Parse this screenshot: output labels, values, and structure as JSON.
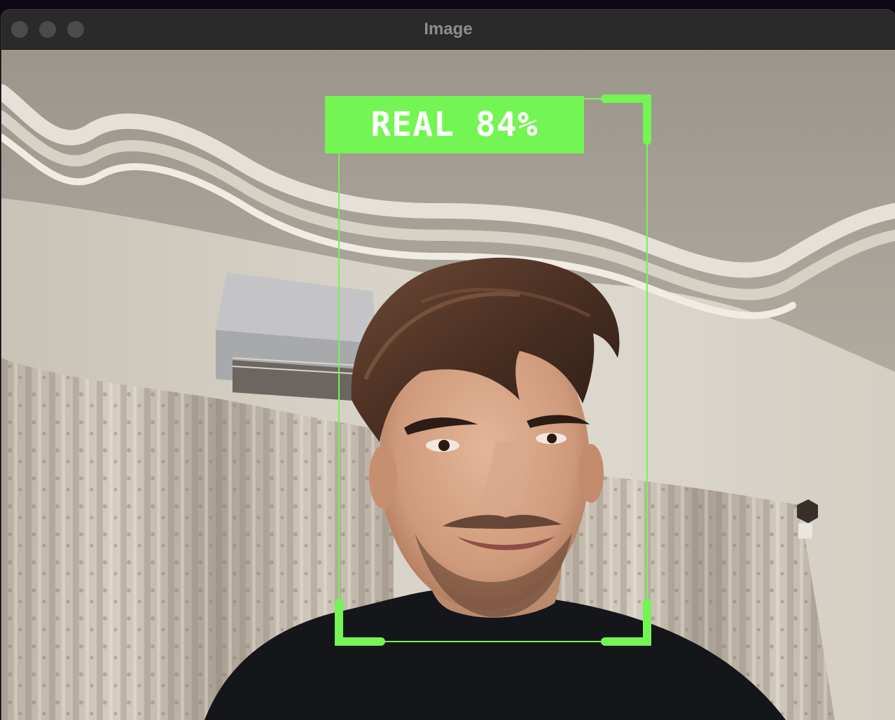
{
  "window": {
    "title": "Image"
  },
  "detection": {
    "label": "REAL 84%",
    "box_color": "#73f553"
  }
}
